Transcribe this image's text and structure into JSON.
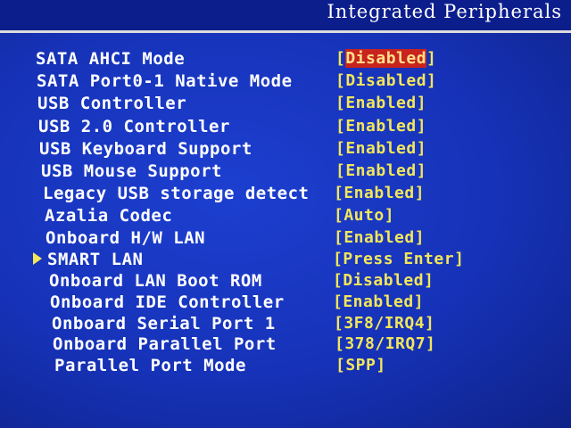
{
  "header": {
    "title": "Integrated Peripherals"
  },
  "settings": [
    {
      "label": "SATA AHCI Mode",
      "value": "Disabled",
      "selected": true
    },
    {
      "label": "SATA Port0-1 Native Mode",
      "value": "Disabled"
    },
    {
      "label": "USB Controller",
      "value": "Enabled"
    },
    {
      "label": "USB 2.0 Controller",
      "value": "Enabled"
    },
    {
      "label": "USB Keyboard Support",
      "value": "Enabled"
    },
    {
      "label": "USB Mouse Support",
      "value": "Enabled"
    },
    {
      "label": "Legacy USB storage detect",
      "value": "Enabled"
    },
    {
      "label": "Azalia Codec",
      "value": "Auto"
    },
    {
      "label": "Onboard H/W LAN",
      "value": "Enabled"
    },
    {
      "label": "SMART LAN",
      "value": "Press Enter",
      "submenu": true
    },
    {
      "label": "Onboard LAN Boot ROM",
      "value": "Disabled"
    },
    {
      "label": "Onboard IDE Controller",
      "value": "Enabled"
    },
    {
      "label": "Onboard Serial Port 1",
      "value": "3F8/IRQ4"
    },
    {
      "label": "Onboard Parallel Port",
      "value": "378/IRQ7"
    },
    {
      "label": "Parallel Port Mode",
      "value": "SPP"
    }
  ],
  "colors": {
    "background": "#1530b8",
    "label_text": "#ffffff",
    "value_text": "#f2e65a",
    "selection_highlight": "#c8231e"
  },
  "icons": {
    "submenu_marker": "submenu-arrow-icon"
  }
}
